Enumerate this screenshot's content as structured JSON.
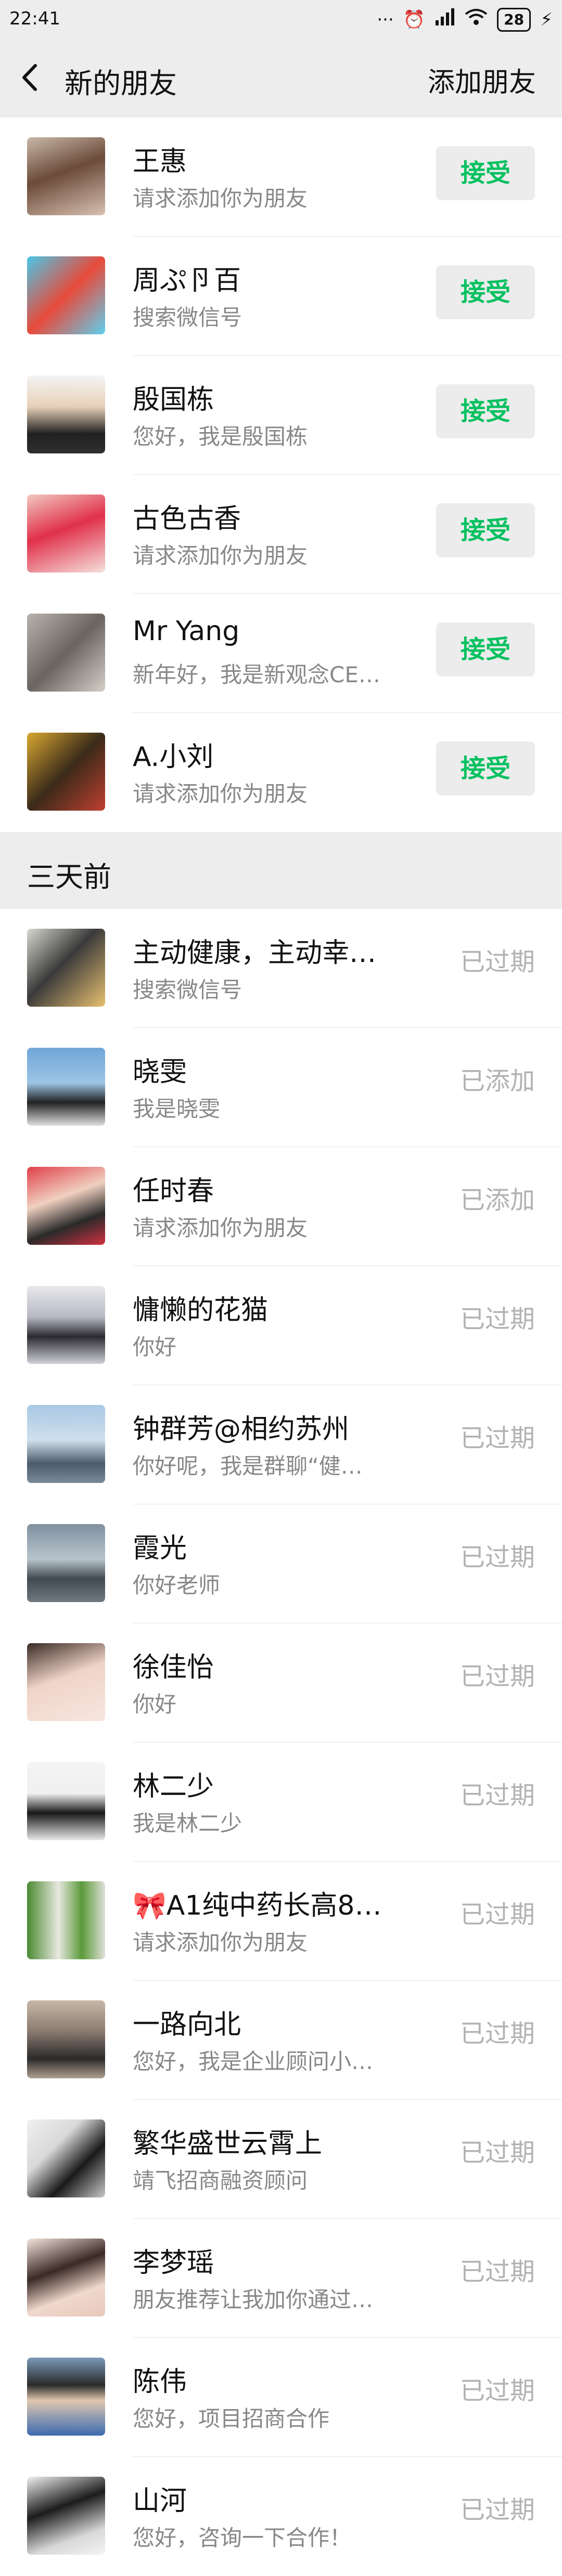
{
  "status_bar": {
    "time": "22:41",
    "battery": "28"
  },
  "header": {
    "title": "新的朋友",
    "add_friend_label": "添加朋友"
  },
  "recent": [
    {
      "name": "王惠",
      "message": "请求添加你为朋友",
      "action": "接受"
    },
    {
      "name": "周ぷ卪百",
      "message": "搜索微信号",
      "action": "接受"
    },
    {
      "name": "殷国栋",
      "message": "您好，我是殷国栋",
      "action": "接受"
    },
    {
      "name": "古色古香",
      "message": "请求添加你为朋友",
      "action": "接受"
    },
    {
      "name": "Mr Yang",
      "message": "新年好，我是新观念CE…",
      "action": "接受"
    },
    {
      "name": "A.小刘",
      "message": "请求添加你为朋友",
      "action": "接受"
    }
  ],
  "section_label": "三天前",
  "older": [
    {
      "name": "主动健康，主动幸…",
      "message": "搜索微信号",
      "status": "已过期"
    },
    {
      "name": "晓雯",
      "message": "我是晓雯",
      "status": "已添加"
    },
    {
      "name": "任时春",
      "message": "请求添加你为朋友",
      "status": "已添加"
    },
    {
      "name": "慵懒的花猫",
      "message": "你好",
      "status": "已过期"
    },
    {
      "name": "钟群芳@相约苏州",
      "message": "你好呢，我是群聊“健…",
      "status": "已过期"
    },
    {
      "name": "霞光",
      "message": "你好老师",
      "status": "已过期"
    },
    {
      "name": "徐佳怡",
      "message": "你好",
      "status": "已过期"
    },
    {
      "name": "林二少",
      "message": "我是林二少",
      "status": "已过期"
    },
    {
      "name": "🎀A1纯中药长高8…",
      "message": "请求添加你为朋友",
      "status": "已过期"
    },
    {
      "name": "一路向北",
      "message": "您好，我是企业顾问小…",
      "status": "已过期"
    },
    {
      "name": "繁华盛世云霄上",
      "message": "靖飞招商融资顾问",
      "status": "已过期"
    },
    {
      "name": "李梦瑶",
      "message": "朋友推荐让我加你通过…",
      "status": "已过期"
    },
    {
      "name": "陈伟",
      "message": "您好，项目招商合作",
      "status": "已过期"
    },
    {
      "name": "山河",
      "message": "您好，咨询一下合作！",
      "status": "已过期"
    }
  ]
}
